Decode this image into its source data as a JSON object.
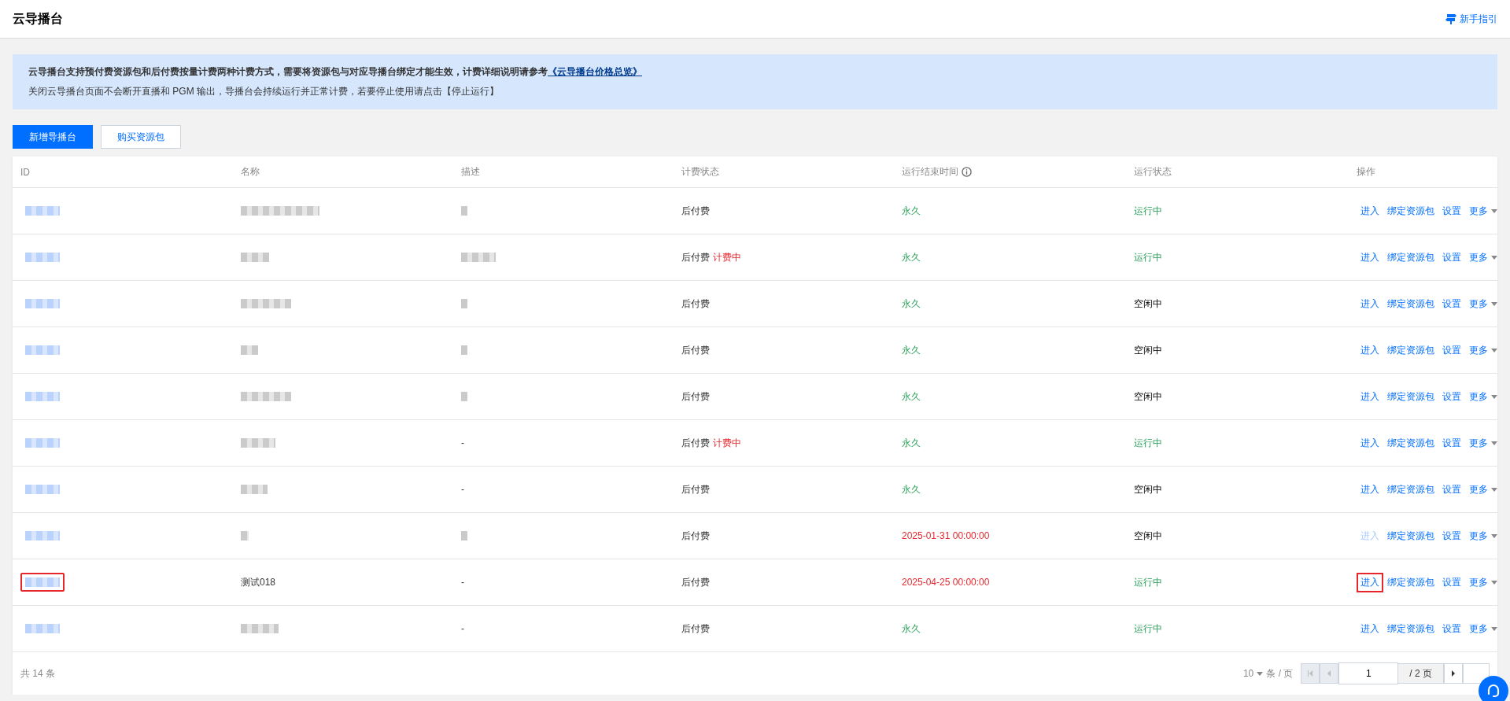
{
  "header": {
    "title": "云导播台",
    "guide_link": "新手指引"
  },
  "notice": {
    "line_1": "云导播台支持预付费资源包和后付费按量计费两种计费方式，需要将资源包与对应导播台绑定才能生效，计费详细说明请参考",
    "line_1_link": "《云导播台价格总览》",
    "line_2": "关闭云导播台页面不会断开直播和 PGM 输出，导播台会持续运行并正常计费，若要停止使用请点击【停止运行】"
  },
  "buttons": [
    {
      "label": "新增导播台",
      "kind": "primary"
    },
    {
      "label": "购买资源包",
      "kind": "secondary"
    }
  ],
  "table": {
    "columns": [
      "ID",
      "名称",
      "描述",
      "计费状态",
      "运行结束时间",
      "运行状态",
      "操作"
    ],
    "rows": [
      {
        "id_redacted": true,
        "name_redacted": true,
        "description_redacted": true,
        "billing": "后付费",
        "billing_tag": null,
        "expires": false,
        "end_time": "永久",
        "status": "运行中",
        "running": true,
        "actions": [
          "进入",
          "绑定资源包",
          "设置",
          "更多"
        ],
        "enter_disabled": false,
        "highlighted": false
      },
      {
        "id_redacted": true,
        "name_redacted": true,
        "description_redacted": true,
        "billing": "后付费",
        "billing_tag": "计费中",
        "expires": false,
        "end_time": "永久",
        "status": "运行中",
        "running": true,
        "actions": [
          "进入",
          "绑定资源包",
          "设置",
          "更多"
        ],
        "enter_disabled": false,
        "highlighted": false
      },
      {
        "id_redacted": true,
        "name_redacted": true,
        "description_redacted": true,
        "billing": "后付费",
        "billing_tag": null,
        "expires": false,
        "end_time": "永久",
        "status": "空闲中",
        "running": false,
        "actions": [
          "进入",
          "绑定资源包",
          "设置",
          "更多"
        ],
        "enter_disabled": false,
        "highlighted": false
      },
      {
        "id_redacted": true,
        "name_redacted": true,
        "description_redacted": true,
        "billing": "后付费",
        "billing_tag": null,
        "expires": false,
        "end_time": "永久",
        "status": "空闲中",
        "running": false,
        "actions": [
          "进入",
          "绑定资源包",
          "设置",
          "更多"
        ],
        "enter_disabled": false,
        "highlighted": false
      },
      {
        "id_redacted": true,
        "name_redacted": true,
        "description_redacted": true,
        "billing": "后付费",
        "billing_tag": null,
        "expires": false,
        "end_time": "永久",
        "status": "空闲中",
        "running": false,
        "actions": [
          "进入",
          "绑定资源包",
          "设置",
          "更多"
        ],
        "enter_disabled": false,
        "highlighted": false
      },
      {
        "id_redacted": true,
        "name_redacted": true,
        "description": "-",
        "billing": "后付费",
        "billing_tag": "计费中",
        "expires": false,
        "end_time": "永久",
        "status": "运行中",
        "running": true,
        "actions": [
          "进入",
          "绑定资源包",
          "设置",
          "更多"
        ],
        "enter_disabled": false,
        "highlighted": false
      },
      {
        "id_redacted": true,
        "name_redacted": true,
        "description": "-",
        "billing": "后付费",
        "billing_tag": null,
        "expires": false,
        "end_time": "永久",
        "status": "空闲中",
        "running": false,
        "actions": [
          "进入",
          "绑定资源包",
          "设置",
          "更多"
        ],
        "enter_disabled": false,
        "highlighted": false
      },
      {
        "id_redacted": true,
        "name_redacted": true,
        "description_redacted": true,
        "billing": "后付费",
        "billing_tag": null,
        "expires": true,
        "end_time": "2025-01-31 00:00:00",
        "status": "空闲中",
        "running": false,
        "actions": [
          "进入",
          "绑定资源包",
          "设置",
          "更多"
        ],
        "enter_disabled": true,
        "highlighted": false
      },
      {
        "id_redacted": true,
        "name": "测试018",
        "description": "-",
        "billing": "后付费",
        "billing_tag": null,
        "expires": true,
        "end_time": "2025-04-25 00:00:00",
        "status": "运行中",
        "running": true,
        "actions": [
          "进入",
          "绑定资源包",
          "设置",
          "更多"
        ],
        "enter_disabled": false,
        "highlighted": true
      },
      {
        "id_redacted": true,
        "name_redacted": true,
        "description": "-",
        "billing": "后付费",
        "billing_tag": null,
        "expires": false,
        "end_time": "永久",
        "status": "运行中",
        "running": true,
        "actions": [
          "进入",
          "绑定资源包",
          "设置",
          "更多"
        ],
        "enter_disabled": false,
        "highlighted": false
      }
    ]
  },
  "footer": {
    "total": "共 14 条",
    "page_size": "10",
    "page_size_unit": "条 / 页",
    "page_input": "1",
    "page_total": "/ 2 页"
  }
}
